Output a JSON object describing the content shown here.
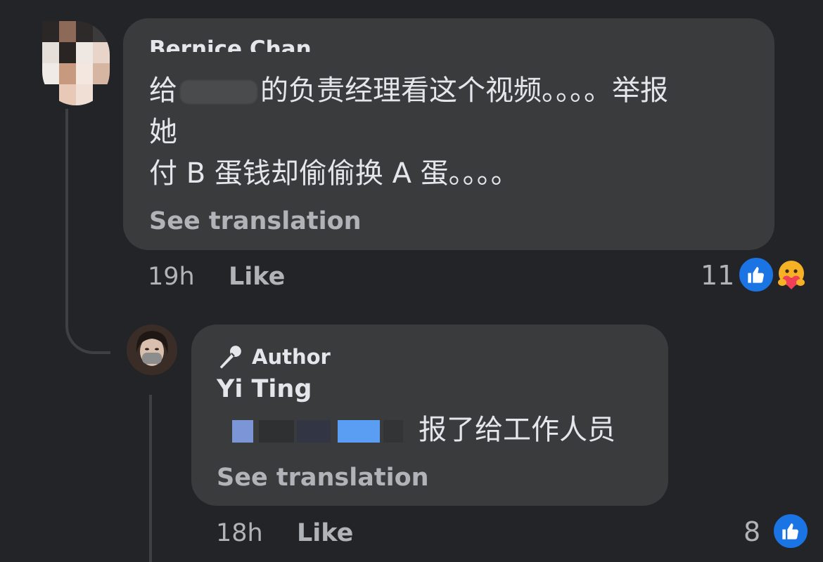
{
  "comments": [
    {
      "author_name": "Bernice Chan",
      "text_lines": [
        "给",
        "的负责经理看这个视频。。。。举报",
        "她",
        "付 B 蛋钱却偷偷换 A 蛋。。。。"
      ],
      "see_translation_label": "See translation",
      "timestamp": "19h",
      "like_label": "Like",
      "reaction_count": "11",
      "reactions": [
        "like-icon",
        "care-icon"
      ]
    },
    {
      "badge_label": "Author",
      "author_name": "Yi Ting",
      "text_after_redaction": "报了给工作人员",
      "see_translation_label": "See translation",
      "timestamp": "18h",
      "like_label": "Like",
      "reaction_count": "8",
      "reactions": [
        "like-icon"
      ]
    }
  ],
  "colors": {
    "background": "#232427",
    "bubble": "#3a3b3c",
    "primary_text": "#e4e6eb",
    "secondary_text": "#b0b3b8",
    "like_blue": "#1b74e4"
  }
}
